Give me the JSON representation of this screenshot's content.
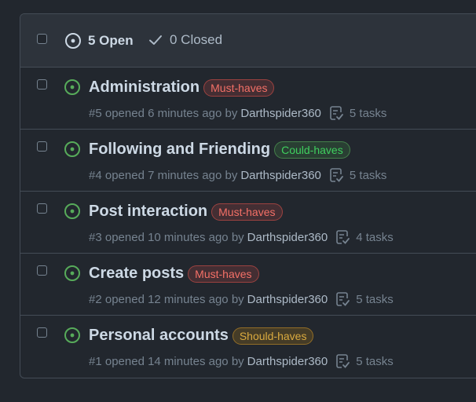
{
  "header": {
    "open_label": "5 Open",
    "closed_label": "0 Closed"
  },
  "colors": {
    "open_icon": "#57ab5a",
    "must_haves": "#e5534b",
    "could_haves": "#57ab5a",
    "should_haves": "#c69026"
  },
  "issues": [
    {
      "title": "Administration",
      "label": "Must-haves",
      "number": "#5",
      "opened": "opened 6 minutes ago by",
      "author": "Darthspider360",
      "tasks": "5 tasks"
    },
    {
      "title": "Following and Friending",
      "label": "Could-haves",
      "number": "#4",
      "opened": "opened 7 minutes ago by",
      "author": "Darthspider360",
      "tasks": "5 tasks"
    },
    {
      "title": "Post interaction",
      "label": "Must-haves",
      "number": "#3",
      "opened": "opened 10 minutes ago by",
      "author": "Darthspider360",
      "tasks": "4 tasks"
    },
    {
      "title": "Create posts",
      "label": "Must-haves",
      "number": "#2",
      "opened": "opened 12 minutes ago by",
      "author": "Darthspider360",
      "tasks": "5 tasks"
    },
    {
      "title": "Personal accounts",
      "label": "Should-haves",
      "number": "#1",
      "opened": "opened 14 minutes ago by",
      "author": "Darthspider360",
      "tasks": "5 tasks"
    }
  ]
}
